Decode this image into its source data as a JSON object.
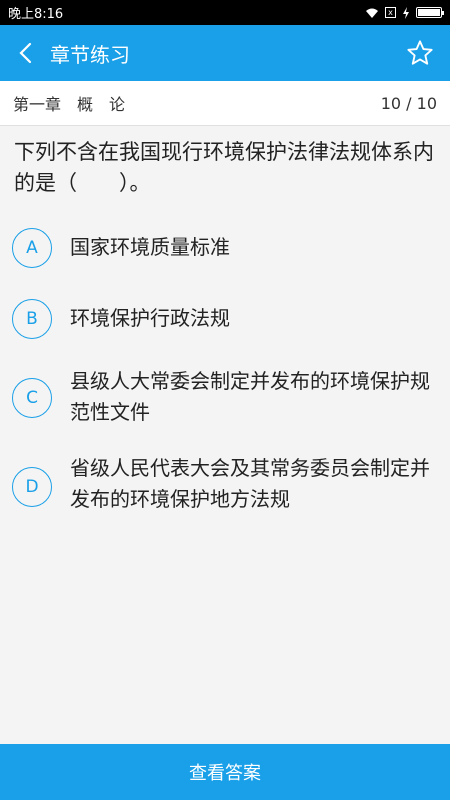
{
  "status_bar": {
    "time": "晚上8:16",
    "sim_label": "x"
  },
  "header": {
    "title": "章节练习",
    "back_icon": "chevron-left-icon",
    "favorite_icon": "star-icon"
  },
  "chapter": {
    "name": "第一章　概　论",
    "progress": "10 / 10"
  },
  "question": {
    "text": "下列不含在我国现行环境保护法律法规体系内的是（　　）。"
  },
  "options": [
    {
      "letter": "A",
      "text": "国家环境质量标准"
    },
    {
      "letter": "B",
      "text": "环境保护行政法规"
    },
    {
      "letter": "C",
      "text": "县级人大常委会制定并发布的环境保护规范性文件"
    },
    {
      "letter": "D",
      "text": "省级人民代表大会及其常务委员会制定并发布的环境保护地方法规"
    }
  ],
  "footer": {
    "button_label": "查看答案"
  },
  "colors": {
    "accent": "#1aa0e8",
    "background": "#f4f4f4"
  }
}
